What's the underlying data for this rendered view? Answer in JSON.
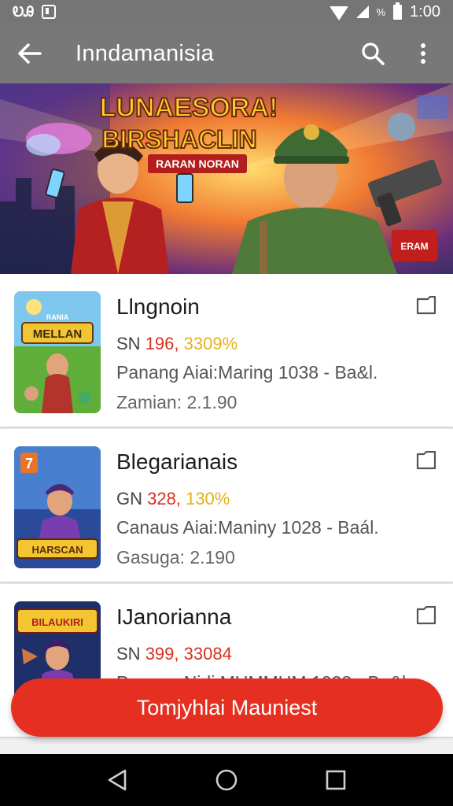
{
  "status_bar": {
    "left_text": "ᎧᎯ",
    "percent": "%",
    "time": "1:00",
    "icons": [
      "notification-icon",
      "wifi-icon",
      "signal-icon",
      "battery-icon"
    ]
  },
  "app_bar": {
    "title": "Inndamanisia",
    "icons": [
      "back-arrow-icon",
      "search-icon",
      "overflow-menu-icon"
    ]
  },
  "banner": {
    "headline_line1": "LUNAESORA!",
    "headline_line2": "BIRSHACLIN",
    "ribbon": "RARAN NORAN",
    "badge": "ERAM"
  },
  "items": [
    {
      "name": "Llngnoin",
      "price_prefix": "SN",
      "price_value": "196,",
      "price_percent": "3309%",
      "meta": "Panang Aiai:Maring 1038 - Ba&l.",
      "meta2": "Zamian:  2.1.90",
      "thumb_text": "MELLAN",
      "thumb_label": "RANIA"
    },
    {
      "name": "Blegarianais",
      "price_prefix": "GN",
      "price_value": "328,",
      "price_percent": "130%",
      "meta": "Canaus Aiai:Maniny 1028 - Baál.",
      "meta2": "Gasuga:  2.190",
      "thumb_text": "HARSCAN",
      "thumb_label": "7"
    },
    {
      "name": "IJanorianna",
      "price_prefix": "SN",
      "price_value": "399,",
      "price_percent": "33084",
      "meta": "Panaga Nidi MUMMUM 1028 - Ba&l.",
      "meta2": "",
      "thumb_text": "BILAUKIRI",
      "thumb_label": ""
    }
  ],
  "cta": {
    "label": "Tomjyhlai Mauniest"
  },
  "nav": {
    "icons": [
      "back-triangle-icon",
      "home-circle-icon",
      "recents-square-icon"
    ]
  },
  "colors": {
    "accent": "#e53021",
    "appbar": "#787878",
    "status_bar": "#757575",
    "price_red": "#d8301f",
    "price_yellow": "#e4b11b"
  }
}
